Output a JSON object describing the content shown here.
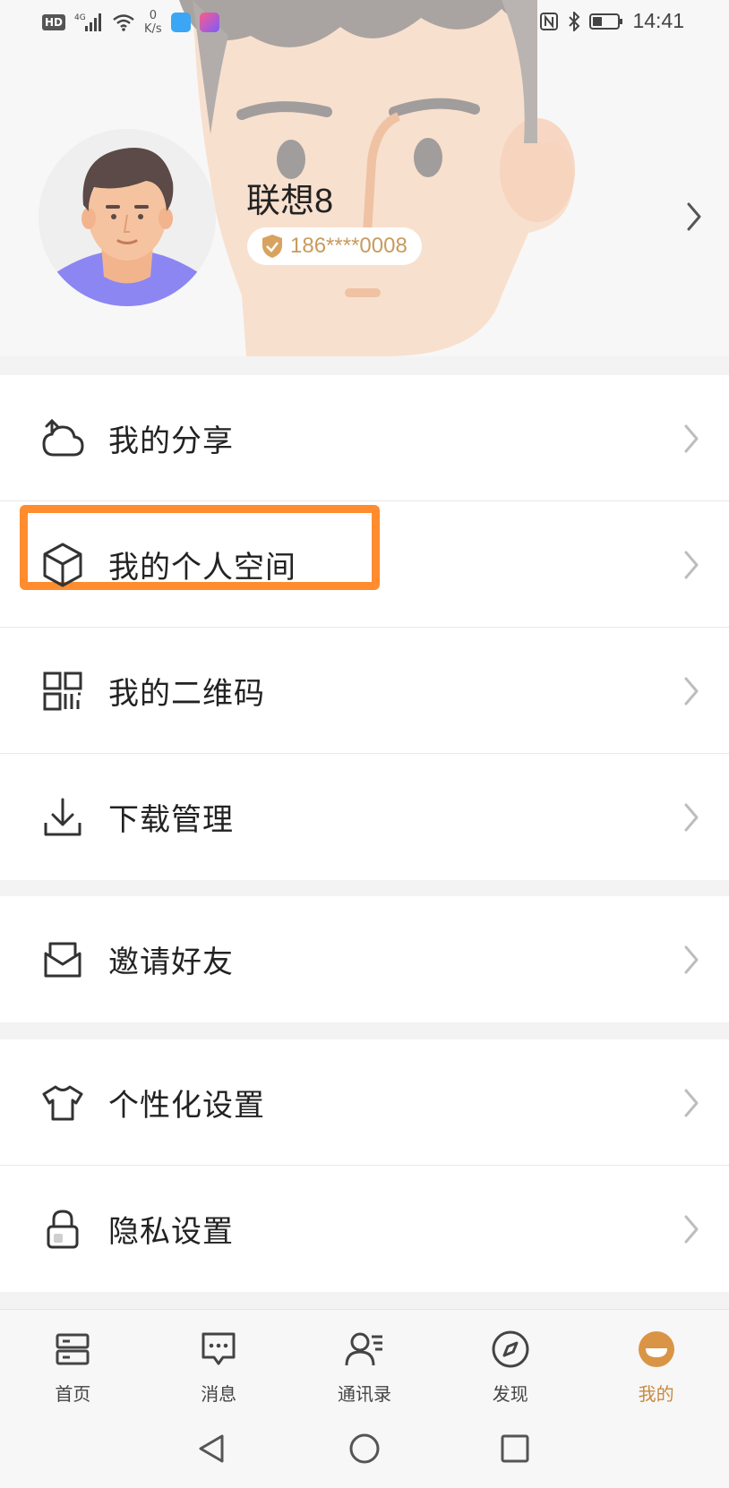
{
  "status_bar": {
    "hd": "HD",
    "network": "4G",
    "speed_value": "0",
    "speed_unit": "K/s",
    "time": "14:41"
  },
  "profile": {
    "username": "联想8",
    "phone": "186****0008"
  },
  "menu": {
    "share": "我的分享",
    "personal_space": "我的个人空间",
    "qr_code": "我的二维码",
    "downloads": "下载管理",
    "invite": "邀请好友",
    "personalize": "个性化设置",
    "privacy": "隐私设置"
  },
  "highlight_color": "#ff8c2e",
  "accent_color": "#c98a40",
  "nav": {
    "tabs": [
      {
        "label": "首页",
        "icon": "home-icon"
      },
      {
        "label": "消息",
        "icon": "message-icon"
      },
      {
        "label": "通讯录",
        "icon": "contacts-icon"
      },
      {
        "label": "发现",
        "icon": "compass-icon"
      },
      {
        "label": "我的",
        "icon": "me-icon",
        "active": true
      }
    ]
  }
}
